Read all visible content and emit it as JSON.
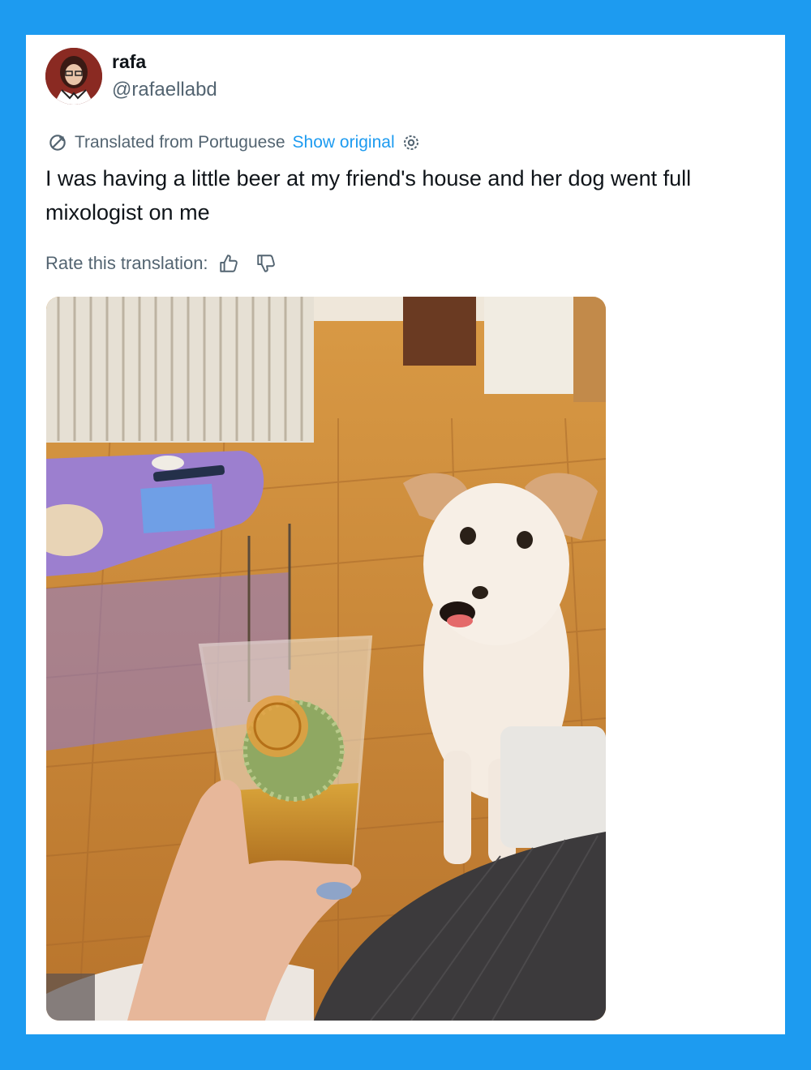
{
  "tweet": {
    "author": {
      "display_name": "rafa",
      "handle": "@rafaellabd"
    },
    "translation_notice": {
      "label": "Translated from Portuguese",
      "show_original_link": "Show original"
    },
    "text": "I was having a little beer at my friend's house and her dog went full mixologist on me",
    "rate_translation_label": "Rate this translation:",
    "icons": {
      "translate": "translate-icon",
      "settings": "gear-icon",
      "thumbs_up": "thumbs-up-icon",
      "thumbs_down": "thumbs-down-icon"
    }
  },
  "colors": {
    "frame": "#1d9bf0",
    "link": "#1d9bf0",
    "secondary_text": "#536471",
    "primary_text": "#0f1419"
  }
}
